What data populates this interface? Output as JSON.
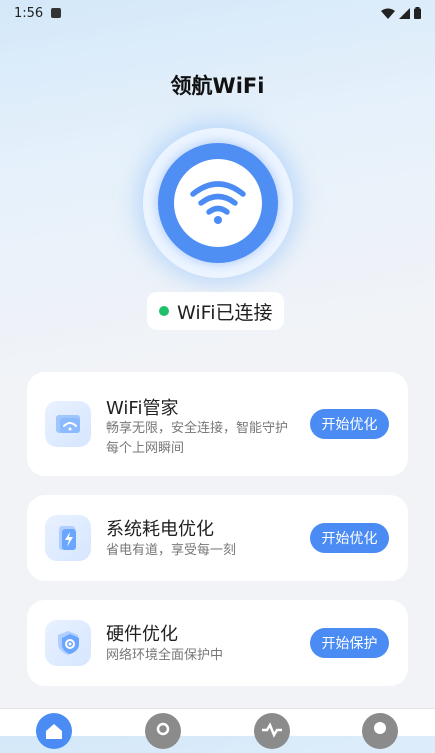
{
  "status_bar": {
    "time": "1:56"
  },
  "app": {
    "title": "领航WiFi"
  },
  "connection": {
    "status": "WiFi已连接"
  },
  "cards": [
    {
      "title": "WiFi管家",
      "desc": "畅享无限，安全连接，智能守护每个上网瞬间",
      "button": "开始优化",
      "icon": "wifi-manager-icon"
    },
    {
      "title": "系统耗电优化",
      "desc": "省电有道，享受每一刻",
      "button": "开始优化",
      "icon": "battery-icon"
    },
    {
      "title": "硬件优化",
      "desc": "网络环境全面保护中",
      "button": "开始保护",
      "icon": "shield-gear-icon"
    }
  ],
  "colors": {
    "accent": "#4a8cf3",
    "connected": "#20c06a"
  },
  "tabs": [
    "home-icon",
    "rocket-icon",
    "heart-pulse-icon",
    "profile-icon"
  ]
}
